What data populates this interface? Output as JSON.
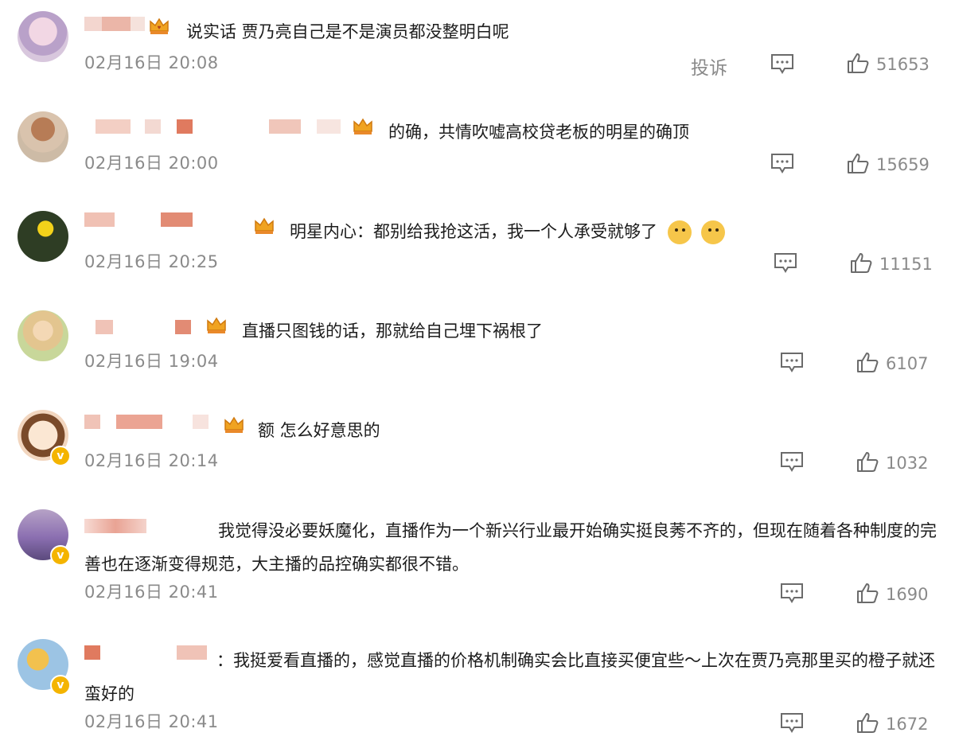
{
  "comments": [
    {
      "text": "说实话 贾乃亮自己是不是演员都没整明白呢",
      "time": "02月16日 20:08",
      "report": "投诉",
      "likes": "51653"
    },
    {
      "text": "的确，共情吹嘘高校贷老板的明星的确顶",
      "time": "02月16日 20:00",
      "likes": "15659"
    },
    {
      "text": "明星内心：都别给我抢这活，我一个人承受就够了",
      "time": "02月16日 20:25",
      "likes": "11151"
    },
    {
      "text": "直播只图钱的话，那就给自己埋下祸根了",
      "time": "02月16日 19:04",
      "likes": "6107"
    },
    {
      "text": "额 怎么好意思的",
      "time": "02月16日 20:14",
      "likes": "1032"
    },
    {
      "text": "我觉得没必要妖魔化，直播作为一个新兴行业最开始确实挺良莠不齐的，但现在随着各种制度的完善也在逐渐变得规范，大主播的品控确实都很不错。",
      "time": "02月16日 20:41",
      "likes": "1690"
    },
    {
      "text": "：我挺爱看直播的，感觉直播的价格机制确实会比直接买便宜些～上次在贾乃亮那里买的橙子就还蛮好的",
      "time": "02月16日 20:41",
      "likes": "1672"
    }
  ],
  "colors": {
    "text": "#1c1c1c",
    "meta": "#8a8a8a",
    "crown": "#f0a321",
    "verified": "#f4b400",
    "blur": "#e9a394"
  },
  "icons": [
    "crown-icon",
    "reply-icon",
    "like-icon",
    "doge-emoji",
    "verified-badge"
  ]
}
